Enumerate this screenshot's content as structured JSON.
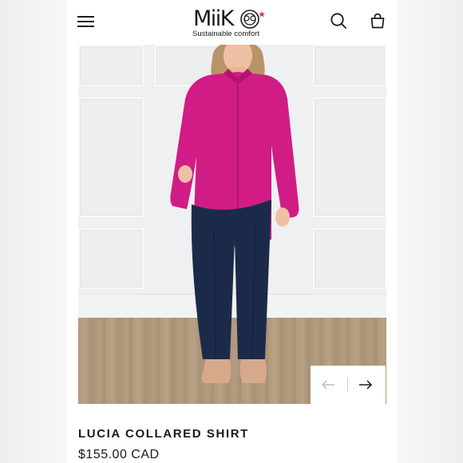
{
  "header": {
    "brand": "MiiK",
    "tagline": "Sustainable comfort",
    "icons": {
      "menu": "hamburger-menu-icon",
      "search": "search-icon",
      "cart": "shopping-bag-icon"
    }
  },
  "carousel": {
    "prev_icon": "arrow-left-icon",
    "next_icon": "arrow-right-icon"
  },
  "product": {
    "title": "LUCIA COLLARED SHIRT",
    "price": "$155.00 CAD",
    "shirt_color": "#d11c86",
    "pants_color": "#1c2a4a"
  },
  "colors": {
    "logo_accent": "#d9383f",
    "text": "#1a1a1a",
    "arrow_disabled": "#bbbbbb"
  }
}
